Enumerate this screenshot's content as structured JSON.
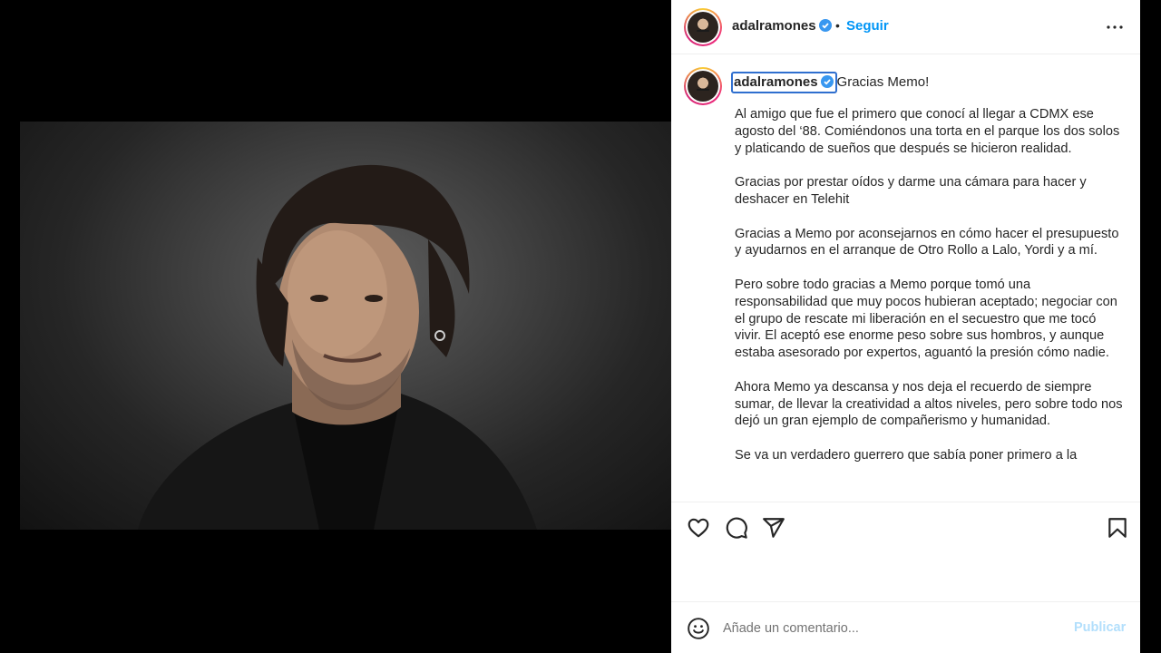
{
  "post": {
    "username": "adalramones",
    "follow_label": "Seguir",
    "dot": "•",
    "caption_first_line": "Gracias Memo!",
    "caption_paragraphs": [
      "Al amigo que fue el primero que conocí al llegar a CDMX ese agosto del ‘88. Comiéndonos una torta en el parque los dos solos y platicando de sueños que después se hicieron realidad.",
      "Gracias por prestar oídos y darme una cámara para hacer y deshacer en Telehit",
      "Gracias a Memo por aconsejarnos en cómo hacer el presupuesto y ayudarnos en el arranque de Otro Rollo a Lalo, Yordi y a mí.",
      "Pero sobre todo gracias a Memo porque tomó una responsabilidad que muy pocos hubieran aceptado; negociar con el grupo de rescate mi liberación en el secuestro que me tocó vivir. El aceptó ese enorme peso sobre sus hombros, y aunque estaba asesorado por expertos, aguantó la presión cómo nadie.",
      "Ahora Memo ya descansa y nos deja el recuerdo de siempre sumar, de llevar la creatividad a altos niveles, pero sobre todo nos dejó un gran ejemplo de compañerismo y humanidad.",
      "Se va un verdadero guerrero que sabía poner primero a la"
    ]
  },
  "comment_bar": {
    "placeholder": "Añade un comentario...",
    "publish_label": "Publicar"
  },
  "colors": {
    "accent": "#0095f6",
    "verified": "#3897f0",
    "publish_disabled": "#b2dffc",
    "text": "#262626"
  },
  "icons": {
    "more": "more-horizontal-icon",
    "like": "heart-icon",
    "comment": "comment-icon",
    "share": "paper-plane-icon",
    "save": "bookmark-icon",
    "emoji": "emoji-icon",
    "verified": "verified-badge-icon"
  }
}
